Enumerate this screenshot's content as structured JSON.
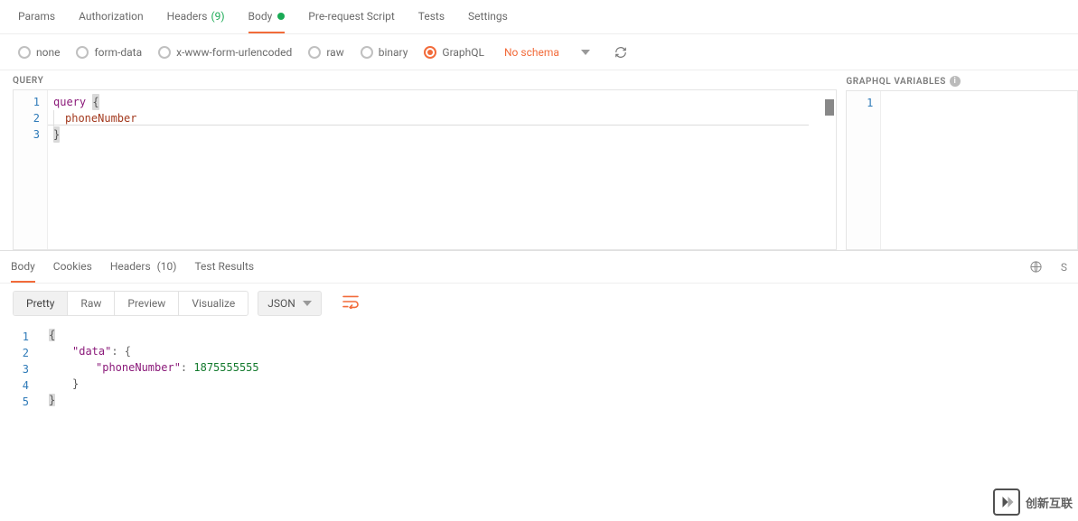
{
  "topTabs": {
    "params": "Params",
    "auth": "Authorization",
    "headers": "Headers",
    "headersCount": "(9)",
    "body": "Body",
    "preReq": "Pre-request Script",
    "tests": "Tests",
    "settings": "Settings"
  },
  "bodyTypes": {
    "none": "none",
    "form": "form-data",
    "xform": "x-www-form-urlencoded",
    "raw": "raw",
    "binary": "binary",
    "graphql": "GraphQL",
    "noSchema": "No schema"
  },
  "panelTitles": {
    "query": "QUERY",
    "vars": "GRAPHQL VARIABLES"
  },
  "queryEditor": {
    "lines": [
      "1",
      "2",
      "3"
    ],
    "l1_kw": "query",
    "l1_brace": "{",
    "l2_field": "phoneNumber",
    "l3_brace": "}"
  },
  "varsEditor": {
    "lines": [
      "1"
    ]
  },
  "respTabs": {
    "body": "Body",
    "cookies": "Cookies",
    "headers": "Headers",
    "headersCount": "(10)",
    "tests": "Test Results",
    "si": "S"
  },
  "respToolbar": {
    "pretty": "Pretty",
    "raw": "Raw",
    "preview": "Preview",
    "visualize": "Visualize",
    "format": "JSON"
  },
  "respBody": {
    "lines": [
      "1",
      "2",
      "3",
      "4",
      "5"
    ],
    "l1": "{",
    "l2_key": "\"data\"",
    "l2_rest": ": {",
    "l3_key": "\"phoneNumber\"",
    "l3_sep": ": ",
    "l3_val": "1875555555",
    "l4": "}",
    "l5": "}"
  },
  "watermark": "创新互联"
}
